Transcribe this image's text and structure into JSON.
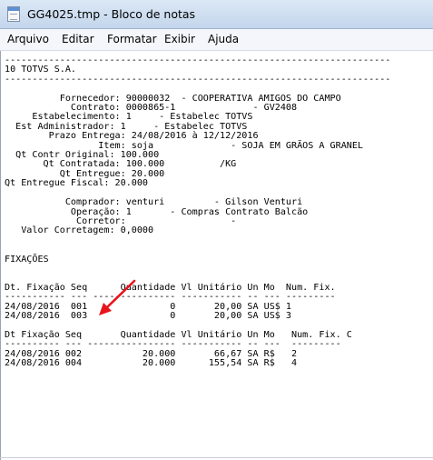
{
  "window": {
    "title": "GG4025.tmp - Bloco de notas"
  },
  "menu": {
    "items": [
      "Arquivo",
      "Editar",
      "Formatar",
      "Exibir",
      "Ajuda"
    ]
  },
  "document": {
    "lines": [
      "----------------------------------------------------------------------",
      "10 TOTVS S.A.",
      "----------------------------------------------------------------------",
      "",
      "          Fornecedor: 90000032  - COOPERATIVA AMIGOS DO CAMPO",
      "            Contrato: 0000865-1              - GV2408",
      "     Estabelecimento: 1     - Estabelec TOTVS",
      "  Est Administrador: 1     - Estabelec TOTVS",
      "        Prazo Entrega: 24/08/2016 à 12/12/2016",
      "                 Item: soja              - SOJA EM GRÃOS A GRANEL",
      "  Qt Contr Original: 100.000",
      "       Qt Contratada: 100.000          /KG",
      "          Qt Entregue: 20.000",
      "Qt Entregue Fiscal: 20.000",
      "",
      "           Comprador: venturi         - Gilson Venturi",
      "            Operação: 1       - Compras Contrato Balcão",
      "             Corretor:                   -",
      "   Valor Corretagem: 0,0000",
      "",
      "",
      "FIXAÇÕES",
      "",
      "",
      "Dt. Fixação Seq      Quantidade Vl Unitário Un Mo  Num. Fix.",
      "----------- --- --------------- ----------- -- --- ---------",
      "24/08/2016  001               0       20,00 SA US$ 1",
      "24/08/2016  003               0       20,00 SA US$ 3",
      "",
      "Dt Fixação Seq       Quantidade Vl Unitário Un Mo   Num. Fix. C",
      "---------- --- ---------------- ----------- -- ---  ---------",
      "24/08/2016 002           20.000       66,67 SA R$   2",
      "24/08/2016 004           20.000      155,54 SA R$   4"
    ]
  },
  "annotation": {
    "arrow_color": "#e8141b"
  }
}
